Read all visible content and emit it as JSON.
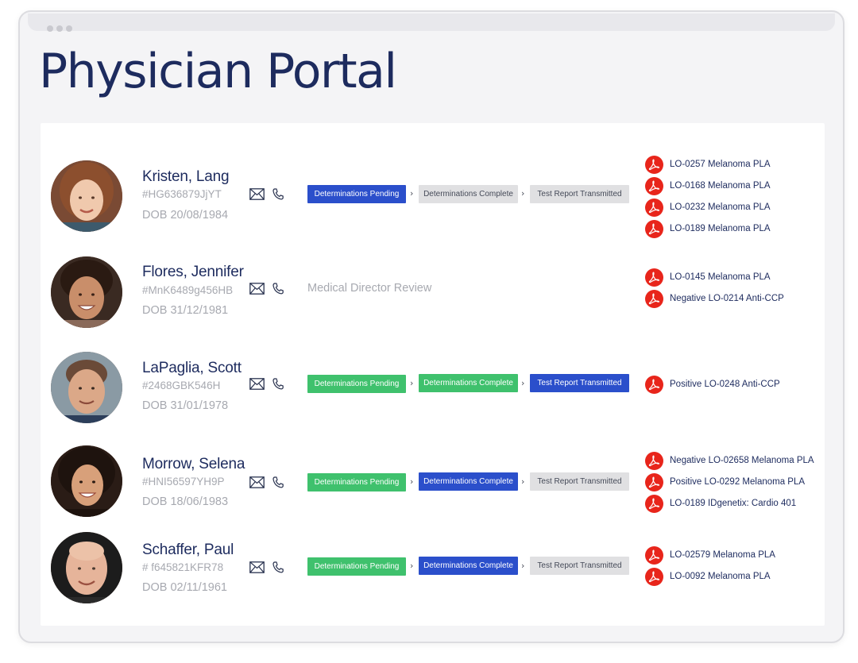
{
  "page": {
    "title": "Physician Portal"
  },
  "colors": {
    "title": "#1d2b5e",
    "stage_active": "#2b4fcb",
    "stage_done": "#3fc16d",
    "stage_pending": "#e0e0e2",
    "pdf_icon": "#e8251b"
  },
  "icons": {
    "contact_email": "envelope-icon",
    "contact_phone": "phone-icon",
    "report": "pdf-icon"
  },
  "patients": [
    {
      "name": "Kristen, Lang",
      "id": "#HG636879JjYT",
      "dob": "DOB 20/08/1984",
      "workflow": [
        {
          "label": "Determinations Pending",
          "state": "active"
        },
        {
          "label": "Determinations Complete",
          "state": "pending"
        },
        {
          "label": "Test Report Transmitted",
          "state": "pending"
        }
      ],
      "reports": [
        "LO-0257 Melanoma PLA",
        "LO-0168 Melanoma PLA",
        "LO-0232 Melanoma PLA",
        "LO-0189 Melanoma PLA"
      ]
    },
    {
      "name": "Flores, Jennifer",
      "id": "#MnK6489g456HB",
      "dob": "DOB 31/12/1981",
      "status_text": "Medical Director Review",
      "reports": [
        "LO-0145 Melanoma PLA",
        "Negative LO-0214 Anti-CCP"
      ]
    },
    {
      "name": "LaPaglia, Scott",
      "id": "#2468GBK546H",
      "dob": "DOB 31/01/1978",
      "workflow": [
        {
          "label": "Determinations Pending",
          "state": "done"
        },
        {
          "label": "Determinations Complete",
          "state": "done"
        },
        {
          "label": "Test Report Transmitted",
          "state": "active"
        }
      ],
      "reports": [
        "Positive LO-0248 Anti-CCP"
      ]
    },
    {
      "name": "Morrow, Selena",
      "id": "#HNI56597YH9P",
      "dob": "DOB 18/06/1983",
      "workflow": [
        {
          "label": "Determinations Pending",
          "state": "done"
        },
        {
          "label": "Determinations Complete",
          "state": "active"
        },
        {
          "label": "Test Report Transmitted",
          "state": "pending"
        }
      ],
      "reports": [
        "Negative LO-02658 Melanoma PLA",
        "Positive LO-0292 Melanoma PLA",
        "LO-0189 IDgenetix: Cardio 401"
      ]
    },
    {
      "name": "Schaffer, Paul",
      "id": "# f645821KFR78",
      "dob": "DOB 02/11/1961",
      "workflow": [
        {
          "label": "Determinations Pending",
          "state": "done"
        },
        {
          "label": "Determinations Complete",
          "state": "active"
        },
        {
          "label": "Test Report Transmitted",
          "state": "pending"
        }
      ],
      "reports": [
        "LO-02579 Melanoma PLA",
        "LO-0092 Melanoma PLA"
      ]
    }
  ]
}
